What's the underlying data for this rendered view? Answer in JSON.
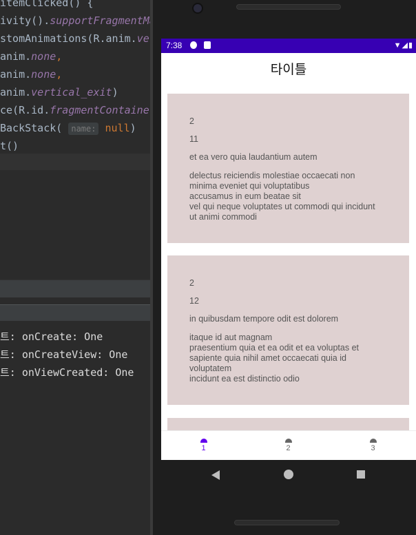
{
  "ide": {
    "code_lines": [
      {
        "segments": [
          {
            "t": "itemClicked() {",
            "c": ""
          }
        ]
      },
      {
        "segments": [
          {
            "t": "ivity().",
            "c": ""
          },
          {
            "t": "supportFragmentMa",
            "c": "it"
          }
        ]
      },
      {
        "segments": [
          {
            "t": "stomAnimations(R.anim.",
            "c": ""
          },
          {
            "t": "ver",
            "c": "it"
          }
        ]
      },
      {
        "segments": [
          {
            "t": "anim.",
            "c": ""
          },
          {
            "t": "none",
            "c": "it"
          },
          {
            "t": ",",
            "c": "kw"
          }
        ]
      },
      {
        "segments": [
          {
            "t": "anim.",
            "c": ""
          },
          {
            "t": "none",
            "c": "it"
          },
          {
            "t": ",",
            "c": "kw"
          }
        ]
      },
      {
        "segments": [
          {
            "t": "anim.",
            "c": ""
          },
          {
            "t": "vertical_exit",
            "c": "it"
          },
          {
            "t": ")",
            "c": ""
          }
        ]
      },
      {
        "segments": [
          {
            "t": "ce(R.id.",
            "c": ""
          },
          {
            "t": "fragmentContainer",
            "c": "it"
          }
        ]
      },
      {
        "segments": [
          {
            "t": "BackStack( ",
            "c": ""
          },
          {
            "t": "name:",
            "c": "hint"
          },
          {
            "t": " ",
            "c": ""
          },
          {
            "t": "null",
            "c": "kw"
          },
          {
            "t": ")",
            "c": ""
          }
        ]
      },
      {
        "segments": [
          {
            "t": "t()",
            "c": ""
          }
        ]
      }
    ],
    "log_lines": [
      "트: onCreate: One",
      "트: onCreateView: One",
      "트: onViewCreated: One"
    ]
  },
  "status_bar": {
    "time": "7:38",
    "right_icons": "▼◢▮"
  },
  "app_bar": {
    "title": "타이틀"
  },
  "cards": [
    {
      "user_id": "2",
      "id": "11",
      "title": "et ea vero quia laudantium autem",
      "body": "delectus reiciendis molestiae occaecati non\nminima eveniet qui voluptatibus\naccusamus in eum beatae sit\nvel qui neque voluptates ut commodi qui incidunt\nut animi commodi"
    },
    {
      "user_id": "2",
      "id": "12",
      "title": "in quibusdam tempore odit est dolorem",
      "body": "itaque id aut magnam\npraesentium quia et ea odit et ea voluptas et\nsapiente quia nihil amet occaecati quia id\nvoluptatem\nincidunt ea est distinctio odio"
    },
    {
      "user_id": "",
      "id": "",
      "title": "",
      "body": ""
    }
  ],
  "bottom_nav": {
    "items": [
      {
        "label": "1",
        "icon": "home-icon",
        "active": true
      },
      {
        "label": "2",
        "icon": "home-icon",
        "active": false
      },
      {
        "label": "3",
        "icon": "home-icon",
        "active": false
      }
    ]
  },
  "colors": {
    "status_bar": "#3700b3",
    "card_bg": "#dfd1d1",
    "nav_active": "#6200ee"
  }
}
